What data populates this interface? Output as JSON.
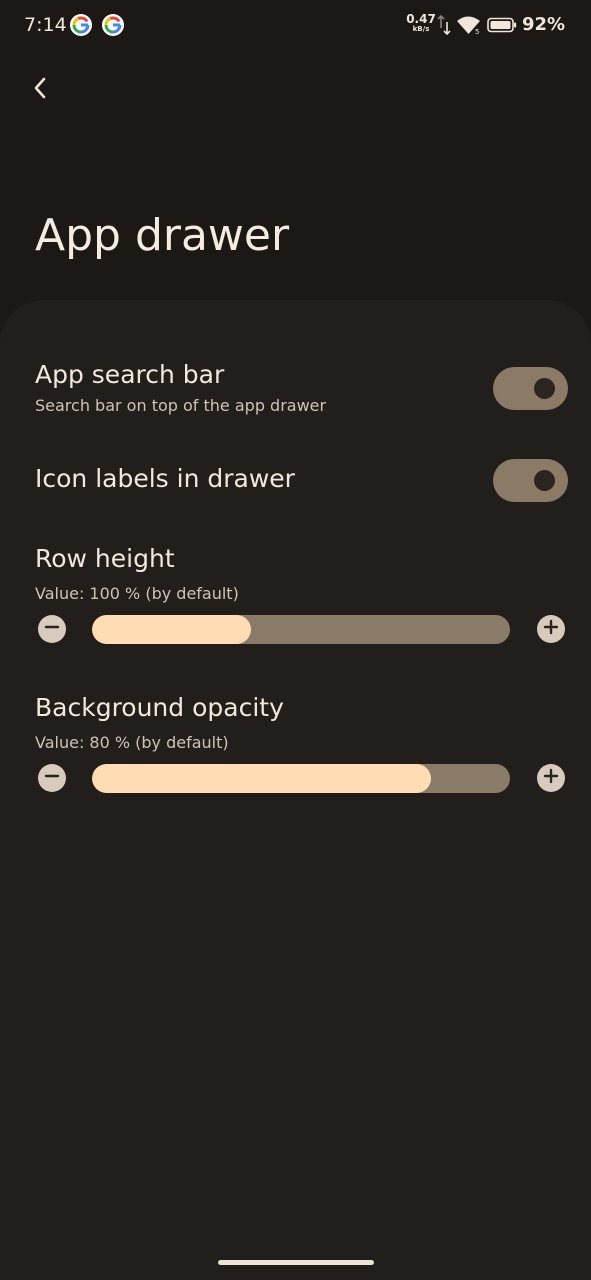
{
  "status_bar": {
    "time": "7:14",
    "notification_icons": [
      "google-icon",
      "google-icon"
    ],
    "net_speed_value": "0.47",
    "net_speed_unit": "kB/s",
    "battery_percent": "92%"
  },
  "header": {
    "back_icon": "chevron-left-icon",
    "title": "App drawer"
  },
  "settings": {
    "app_search_bar": {
      "title": "App search bar",
      "subtitle": "Search bar on top of the app drawer",
      "enabled": true
    },
    "icon_labels": {
      "title": "Icon labels in drawer",
      "enabled": true
    },
    "row_height": {
      "title": "Row height",
      "value_text": "Value: 100 % (by default)",
      "fill_fraction": 0.38
    },
    "background_opacity": {
      "title": "Background opacity",
      "value_text": "Value: 80 % (by default)",
      "fill_fraction": 0.81
    }
  },
  "colors": {
    "background": "#1b1815",
    "card": "#211e1b",
    "toggle_on": "#8b7a65",
    "slider_fill": "#ffdcb4",
    "slider_track": "#8a7b69"
  }
}
